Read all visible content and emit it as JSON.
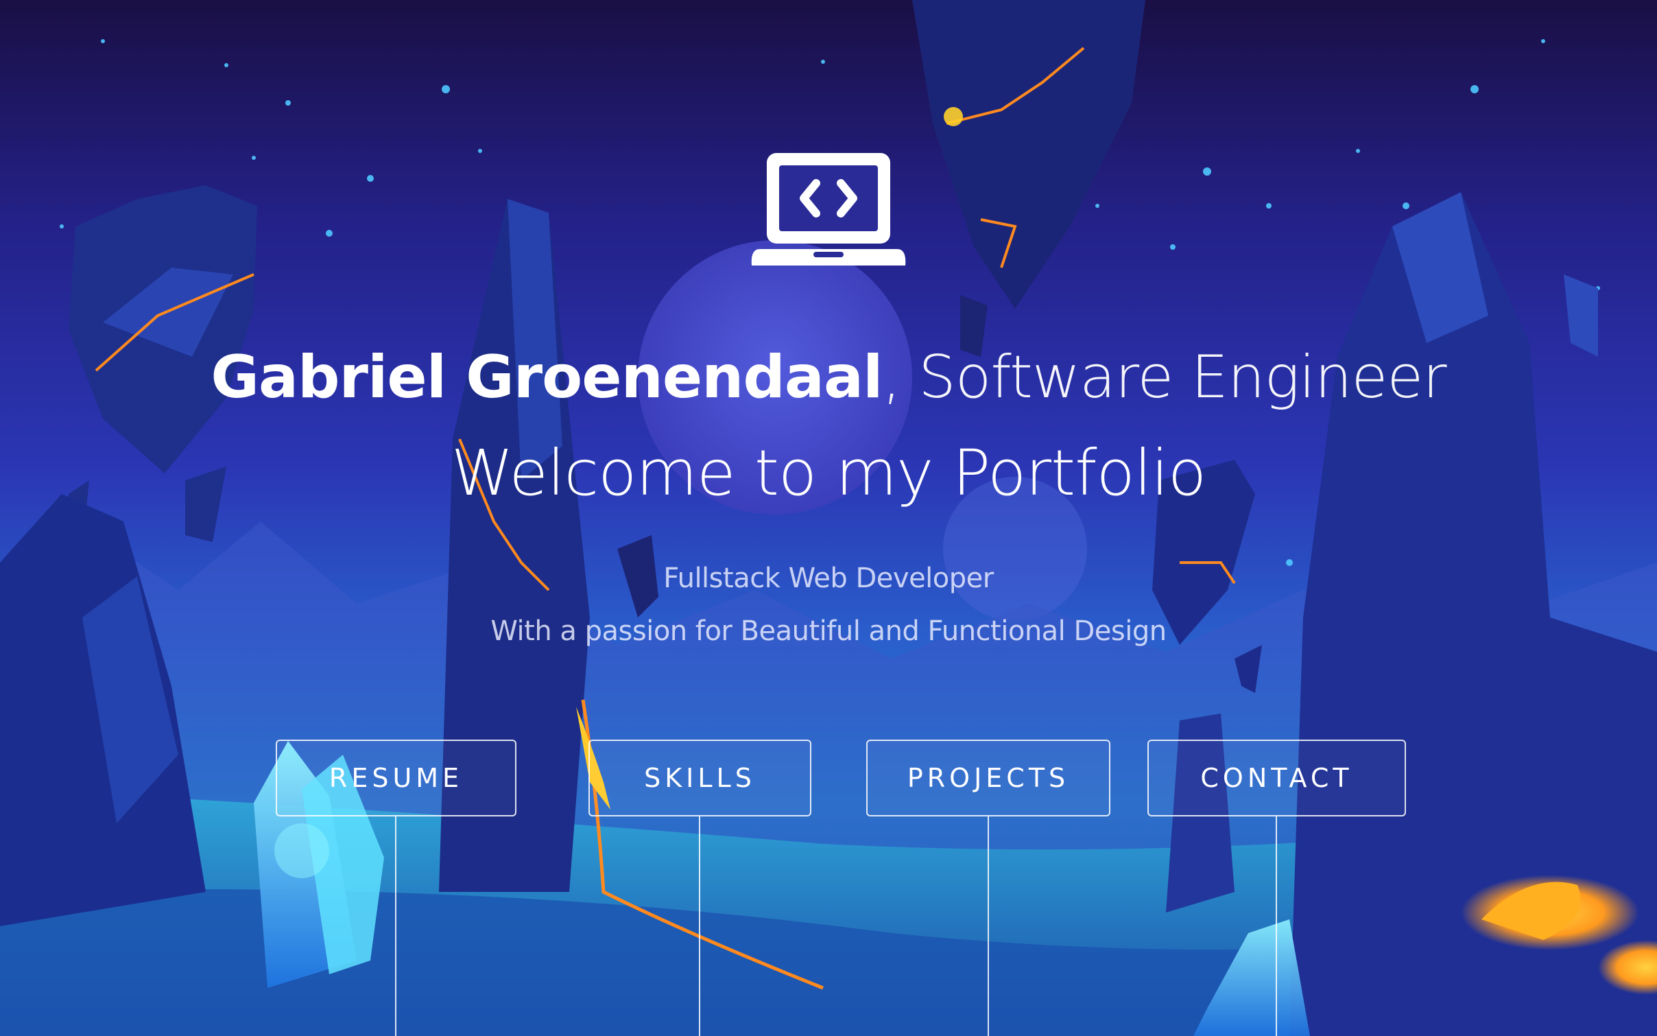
{
  "hero": {
    "name": "Gabriel Groenendaal",
    "role": ", Software Engineer",
    "welcome": "Welcome to my Portfolio",
    "subtitle": "Fullstack Web Developer",
    "tagline": "With a passion for Beautiful and Functional Design",
    "icon": "laptop-code-icon"
  },
  "nav": {
    "resume": "RESUME",
    "skills": "SKILLS",
    "projects": "PROJECTS",
    "contact": "CONTACT"
  },
  "colors": {
    "accent_lava": "#ff8a1f",
    "crystal": "#4fd8ff",
    "sky_top": "#1a0f45",
    "text": "#ffffff"
  }
}
